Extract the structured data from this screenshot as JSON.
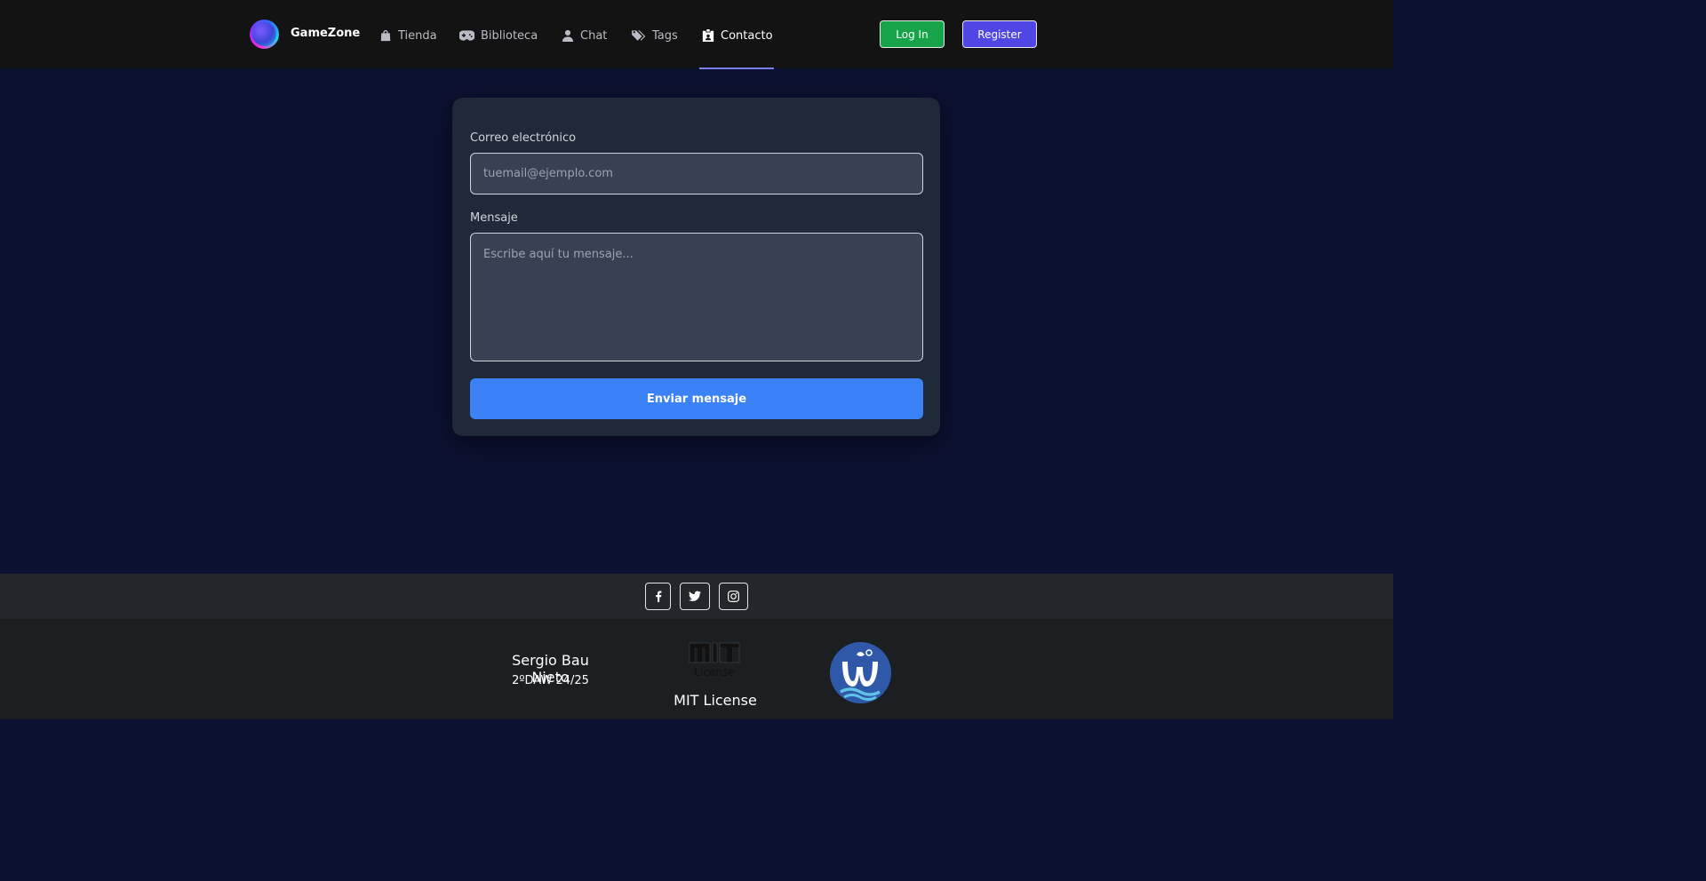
{
  "nav": {
    "brand": "GameZone",
    "items": [
      {
        "label": "Tienda",
        "icon": "shopping-bag-icon"
      },
      {
        "label": "Biblioteca",
        "icon": "gamepad-icon"
      },
      {
        "label": "Chat",
        "icon": "user-icon"
      },
      {
        "label": "Tags",
        "icon": "tags-icon"
      },
      {
        "label": "Contacto",
        "icon": "contact-card-icon",
        "active": true
      }
    ],
    "login_label": "Log In",
    "register_label": "Register"
  },
  "form": {
    "email_label": "Correo electrónico",
    "email_placeholder": "tuemail@ejemplo.com",
    "message_label": "Mensaje",
    "message_placeholder": "Escribe aquí tu mensaje...",
    "submit_label": "Enviar mensaje"
  },
  "social": [
    {
      "name": "facebook",
      "icon": "facebook-icon"
    },
    {
      "name": "twitter",
      "icon": "twitter-icon"
    },
    {
      "name": "instagram",
      "icon": "instagram-icon"
    }
  ],
  "footer": {
    "author": "Sergio Bau Nieto",
    "course": "2ºDAW 24/25",
    "license_logo_text": "License",
    "license": "MIT License"
  },
  "colors": {
    "page_bg": "#0b1130",
    "nav_bg": "#131313",
    "card_bg": "#1f2937",
    "login_green": "#16a34a",
    "register_indigo": "#4f46e5",
    "submit_blue": "#3b82f6",
    "active_underline": "#7b7fef"
  }
}
